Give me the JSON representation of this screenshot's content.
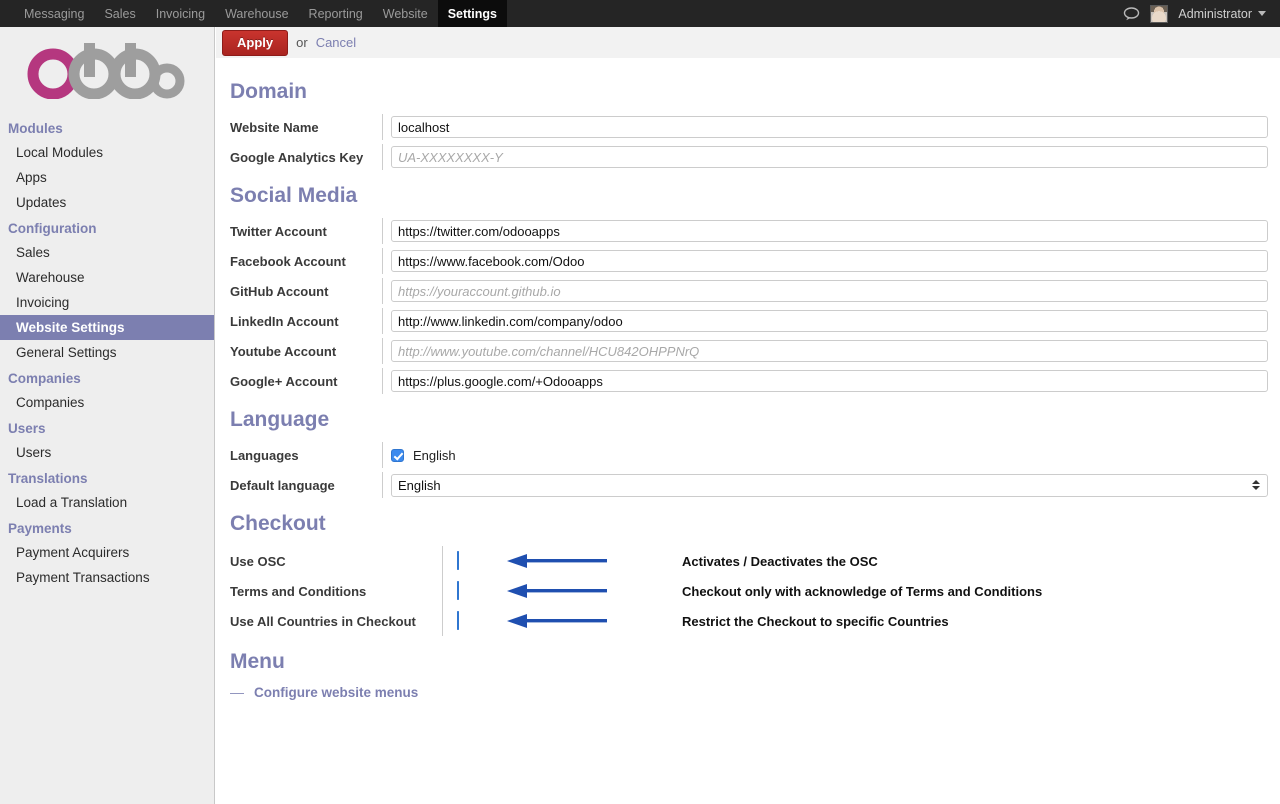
{
  "topnav": {
    "items": [
      {
        "label": "Messaging",
        "active": false
      },
      {
        "label": "Sales",
        "active": false
      },
      {
        "label": "Invoicing",
        "active": false
      },
      {
        "label": "Warehouse",
        "active": false
      },
      {
        "label": "Reporting",
        "active": false
      },
      {
        "label": "Website",
        "active": false
      },
      {
        "label": "Settings",
        "active": true
      }
    ],
    "chat_icon": "chat-bubble-icon",
    "user": "Administrator",
    "avatar": "user-avatar"
  },
  "sidebar": {
    "logo": "odoo-logo",
    "groups": [
      {
        "title": "Modules",
        "items": [
          {
            "label": "Local Modules",
            "active": false
          },
          {
            "label": "Apps",
            "active": false
          },
          {
            "label": "Updates",
            "active": false
          }
        ]
      },
      {
        "title": "Configuration",
        "items": [
          {
            "label": "Sales",
            "active": false
          },
          {
            "label": "Warehouse",
            "active": false
          },
          {
            "label": "Invoicing",
            "active": false
          },
          {
            "label": "Website Settings",
            "active": true
          },
          {
            "label": "General Settings",
            "active": false
          }
        ]
      },
      {
        "title": "Companies",
        "items": [
          {
            "label": "Companies",
            "active": false
          }
        ]
      },
      {
        "title": "Users",
        "items": [
          {
            "label": "Users",
            "active": false
          }
        ]
      },
      {
        "title": "Translations",
        "items": [
          {
            "label": "Load a Translation",
            "active": false
          }
        ]
      },
      {
        "title": "Payments",
        "items": [
          {
            "label": "Payment Acquirers",
            "active": false
          },
          {
            "label": "Payment Transactions",
            "active": false
          }
        ]
      }
    ]
  },
  "toolbar": {
    "apply_label": "Apply",
    "or_label": "or",
    "cancel_label": "Cancel"
  },
  "sections": {
    "domain": {
      "title": "Domain",
      "fields": [
        {
          "label": "Website Name",
          "value": "localhost",
          "placeholder": ""
        },
        {
          "label": "Google Analytics Key",
          "value": "",
          "placeholder": "UA-XXXXXXXX-Y"
        }
      ]
    },
    "social": {
      "title": "Social Media",
      "fields": [
        {
          "label": "Twitter Account",
          "value": "https://twitter.com/odooapps",
          "placeholder": ""
        },
        {
          "label": "Facebook Account",
          "value": "https://www.facebook.com/Odoo",
          "placeholder": ""
        },
        {
          "label": "GitHub Account",
          "value": "",
          "placeholder": "https://youraccount.github.io"
        },
        {
          "label": "LinkedIn Account",
          "value": "http://www.linkedin.com/company/odoo",
          "placeholder": ""
        },
        {
          "label": "Youtube Account",
          "value": "",
          "placeholder": "http://www.youtube.com/channel/HCU842OHPPNrQ"
        },
        {
          "label": "Google+ Account",
          "value": "https://plus.google.com/+Odooapps",
          "placeholder": ""
        }
      ]
    },
    "language": {
      "title": "Language",
      "languages_label": "Languages",
      "languages_checkbox_label": "English",
      "languages_checked": true,
      "default_label": "Default language",
      "default_value": "English",
      "default_options": [
        "English"
      ]
    },
    "checkout": {
      "title": "Checkout",
      "rows": [
        {
          "label": "Use OSC",
          "checked": true,
          "annotation": "Activates / Deactivates the OSC"
        },
        {
          "label": "Terms and Conditions",
          "checked": true,
          "annotation": "Checkout only with acknowledge of Terms and Conditions"
        },
        {
          "label": "Use All Countries in Checkout",
          "checked": true,
          "annotation": "Restrict the Checkout to specific Countries"
        }
      ]
    },
    "menu": {
      "title": "Menu",
      "dash": "—",
      "link_label": "Configure website menus"
    }
  },
  "colors": {
    "accent_purple": "#7c7fb0",
    "apply_red": "#b52a25",
    "checkbox_blue": "#3b8aee",
    "annotation_arrow": "#1f4fb0",
    "topbar_dark": "#252525"
  }
}
